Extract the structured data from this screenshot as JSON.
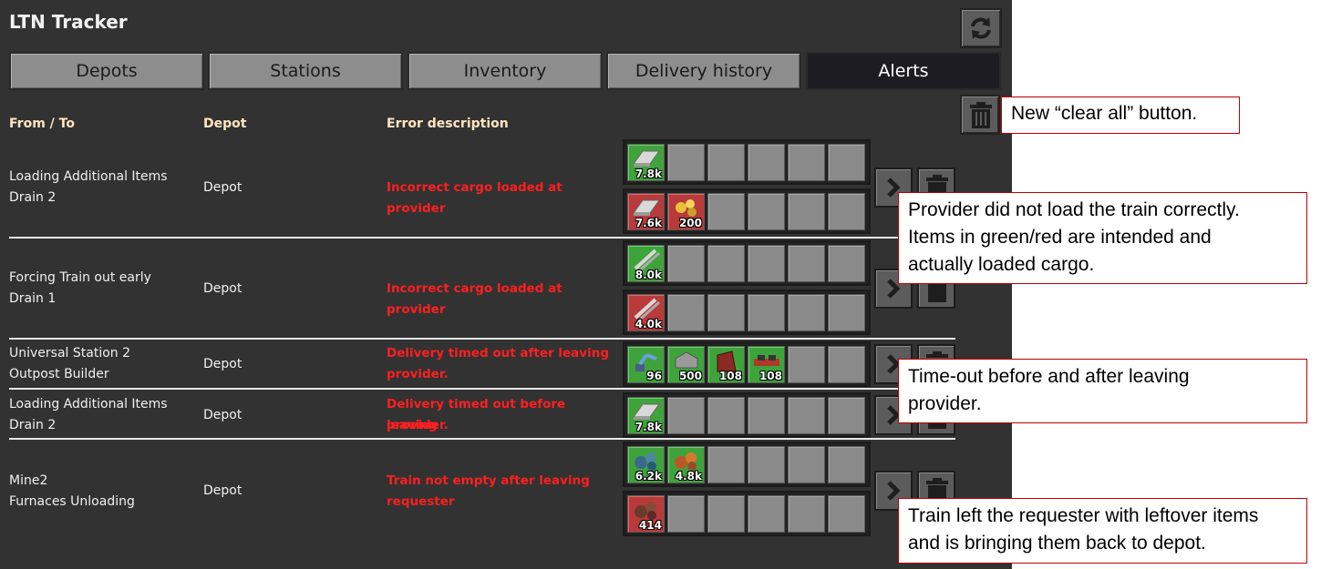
{
  "app": {
    "title": "LTN Tracker",
    "refresh_icon": "refresh-icon"
  },
  "tabs": [
    {
      "label": "Depots",
      "active": false
    },
    {
      "label": "Stations",
      "active": false
    },
    {
      "label": "Inventory",
      "active": false
    },
    {
      "label": "Delivery history",
      "active": false
    },
    {
      "label": "Alerts",
      "active": true
    }
  ],
  "columns": {
    "from_to": "From / To",
    "depot": "Depot",
    "error": "Error description"
  },
  "clear_all_icon": "trash-icon",
  "alerts": [
    {
      "from": "Loading Additional Items",
      "to": "Drain 2",
      "depot": "Depot",
      "error": "Incorrect cargo loaded at provider",
      "intended": [
        {
          "icon": "plate-icon",
          "count": "7.8k"
        }
      ],
      "actual": [
        {
          "icon": "plate-icon",
          "count": "7.6k"
        },
        {
          "icon": "ore-icon",
          "count": "200"
        }
      ]
    },
    {
      "from": "Forcing Train out early",
      "to": "Drain 1",
      "depot": "Depot",
      "error": "Incorrect cargo loaded at provider",
      "intended": [
        {
          "icon": "rod-icon",
          "count": "8.0k"
        }
      ],
      "actual": [
        {
          "icon": "rod-icon",
          "count": "4.0k"
        }
      ]
    },
    {
      "from": "Universal Station 2",
      "to": "Outpost Builder",
      "depot": "Depot",
      "error_line1": "Delivery timed out after leaving",
      "error_line2": "provider.",
      "cargo": [
        {
          "icon": "inserter-icon",
          "count": "96"
        },
        {
          "icon": "wall-icon",
          "count": "500"
        },
        {
          "icon": "belt-icon",
          "count": "108"
        },
        {
          "icon": "splitter-icon",
          "count": "108"
        }
      ]
    },
    {
      "from": "Loading Additional Items",
      "to": "Drain 2",
      "depot": "Depot",
      "error_line1": "Delivery timed out before leaving",
      "error_line2": "provider.",
      "cargo": [
        {
          "icon": "plate-icon",
          "count": "7.8k"
        }
      ]
    },
    {
      "from": "Mine2",
      "to": "Furnaces Unloading",
      "depot": "Depot",
      "error_line1": "Train not empty after leaving",
      "error_line2": "requester",
      "intended": [
        {
          "icon": "ore-green-icon",
          "count": "6.2k"
        },
        {
          "icon": "ore-orange-icon",
          "count": "4.8k"
        }
      ],
      "actual": [
        {
          "icon": "ore-red-icon",
          "count": "414"
        }
      ]
    }
  ],
  "callouts": {
    "clear_all": "New “clear all” button.",
    "provider": [
      "Provider did not load the train correctly.",
      "Items in green/red are intended and",
      "actually loaded cargo."
    ],
    "timeout": [
      "Time-out before and after leaving",
      "provider."
    ],
    "leftover": [
      "Train left the requester with leftover items",
      "and is bringing them back to depot."
    ]
  },
  "colors": {
    "panel": "#323232",
    "error_text": "#ff1f1f",
    "intended_slot": "#3fa33c",
    "actual_slot": "#b83a3a",
    "callout_border": "#c00000"
  }
}
